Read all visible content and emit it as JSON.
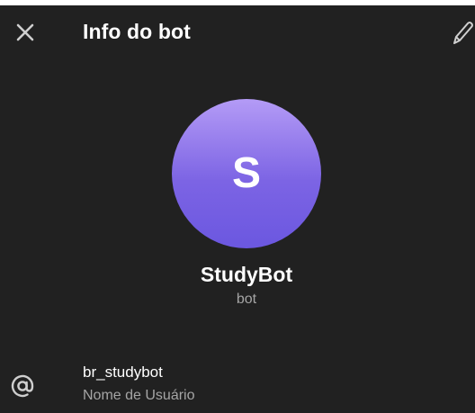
{
  "header": {
    "title": "Info do bot",
    "close_icon": "close-icon",
    "edit_icon": "pencil-icon"
  },
  "profile": {
    "avatar_letter": "S",
    "name": "StudyBot",
    "type": "bot"
  },
  "info": {
    "username": "br_studybot",
    "username_caption": "Nome de Usuário",
    "icon": "at-icon"
  },
  "colors": {
    "background": "#212121",
    "avatar_gradient_top": "#b49bf6",
    "avatar_gradient_bottom": "#6b57e0",
    "secondary_text": "#a5a5a5"
  }
}
